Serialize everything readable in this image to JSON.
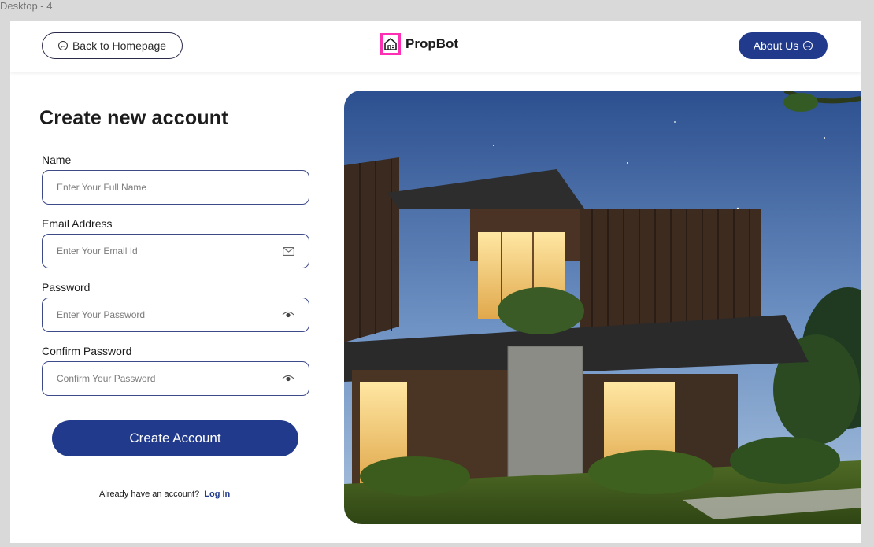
{
  "frame_label": "Desktop - 4",
  "header": {
    "back_label": "Back to Homepage",
    "brand": "PropBot",
    "about_label": "About Us"
  },
  "form": {
    "title": "Create new account",
    "fields": [
      {
        "label": "Name",
        "placeholder": "Enter Your Full Name",
        "icon": ""
      },
      {
        "label": "Email Address",
        "placeholder": "Enter Your Email Id",
        "icon": "mail-icon"
      },
      {
        "label": "Password",
        "placeholder": "Enter Your Password",
        "icon": "eye-icon"
      },
      {
        "label": "Confirm Password",
        "placeholder": "Confirm Your Password",
        "icon": "eye-icon"
      }
    ],
    "submit_label": "Create Account",
    "login_prompt": "Already have an account?",
    "login_link": "Log In"
  },
  "colors": {
    "primary": "#213a8c",
    "logo_accent": "#ff2fb5",
    "canvas": "#d9d9d9"
  }
}
